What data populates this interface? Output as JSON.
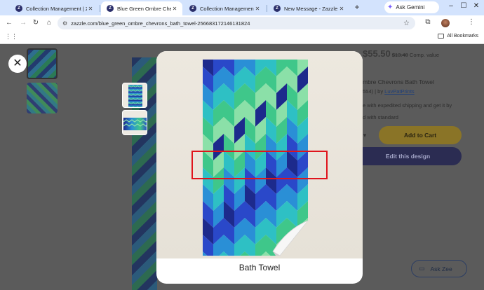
{
  "browser": {
    "tabs": [
      {
        "title": "Collection Management | Zazzle",
        "active": false
      },
      {
        "title": "Blue Green Ombre Chevrons",
        "active": true
      },
      {
        "title": "Collection Management | Zazzle",
        "active": false
      },
      {
        "title": "New Message - Zazzle",
        "active": false
      }
    ],
    "gemini_label": "Ask Gemini",
    "url": "zazzle.com/blue_green_ombre_chevrons_bath_towel-256683172146131824",
    "all_bookmarks_label": "All Bookmarks"
  },
  "page_bg": {
    "price": "$55.50",
    "old_price": "$13.40",
    "comp_label": "Comp. value",
    "title_fragment": "mbre Chevrons Bath Towel",
    "rating_count": "554)",
    "by_label": "| by",
    "designer": "LuvPatPrints",
    "shipping_text": "e with expedited shipping and get it by",
    "standard_text": "d with standard",
    "add_to_cart_label": "Add to Cart",
    "edit_design_label": "Edit this design",
    "ask_zee_label": "Ask Zee"
  },
  "modal": {
    "caption": "Bath Towel"
  },
  "colors": {
    "highlight": "#e0141c",
    "chevron_palette": [
      "#1d2a8c",
      "#2a48c9",
      "#2a8fd6",
      "#2ec0c4",
      "#3fc78a",
      "#8be0a8"
    ]
  }
}
